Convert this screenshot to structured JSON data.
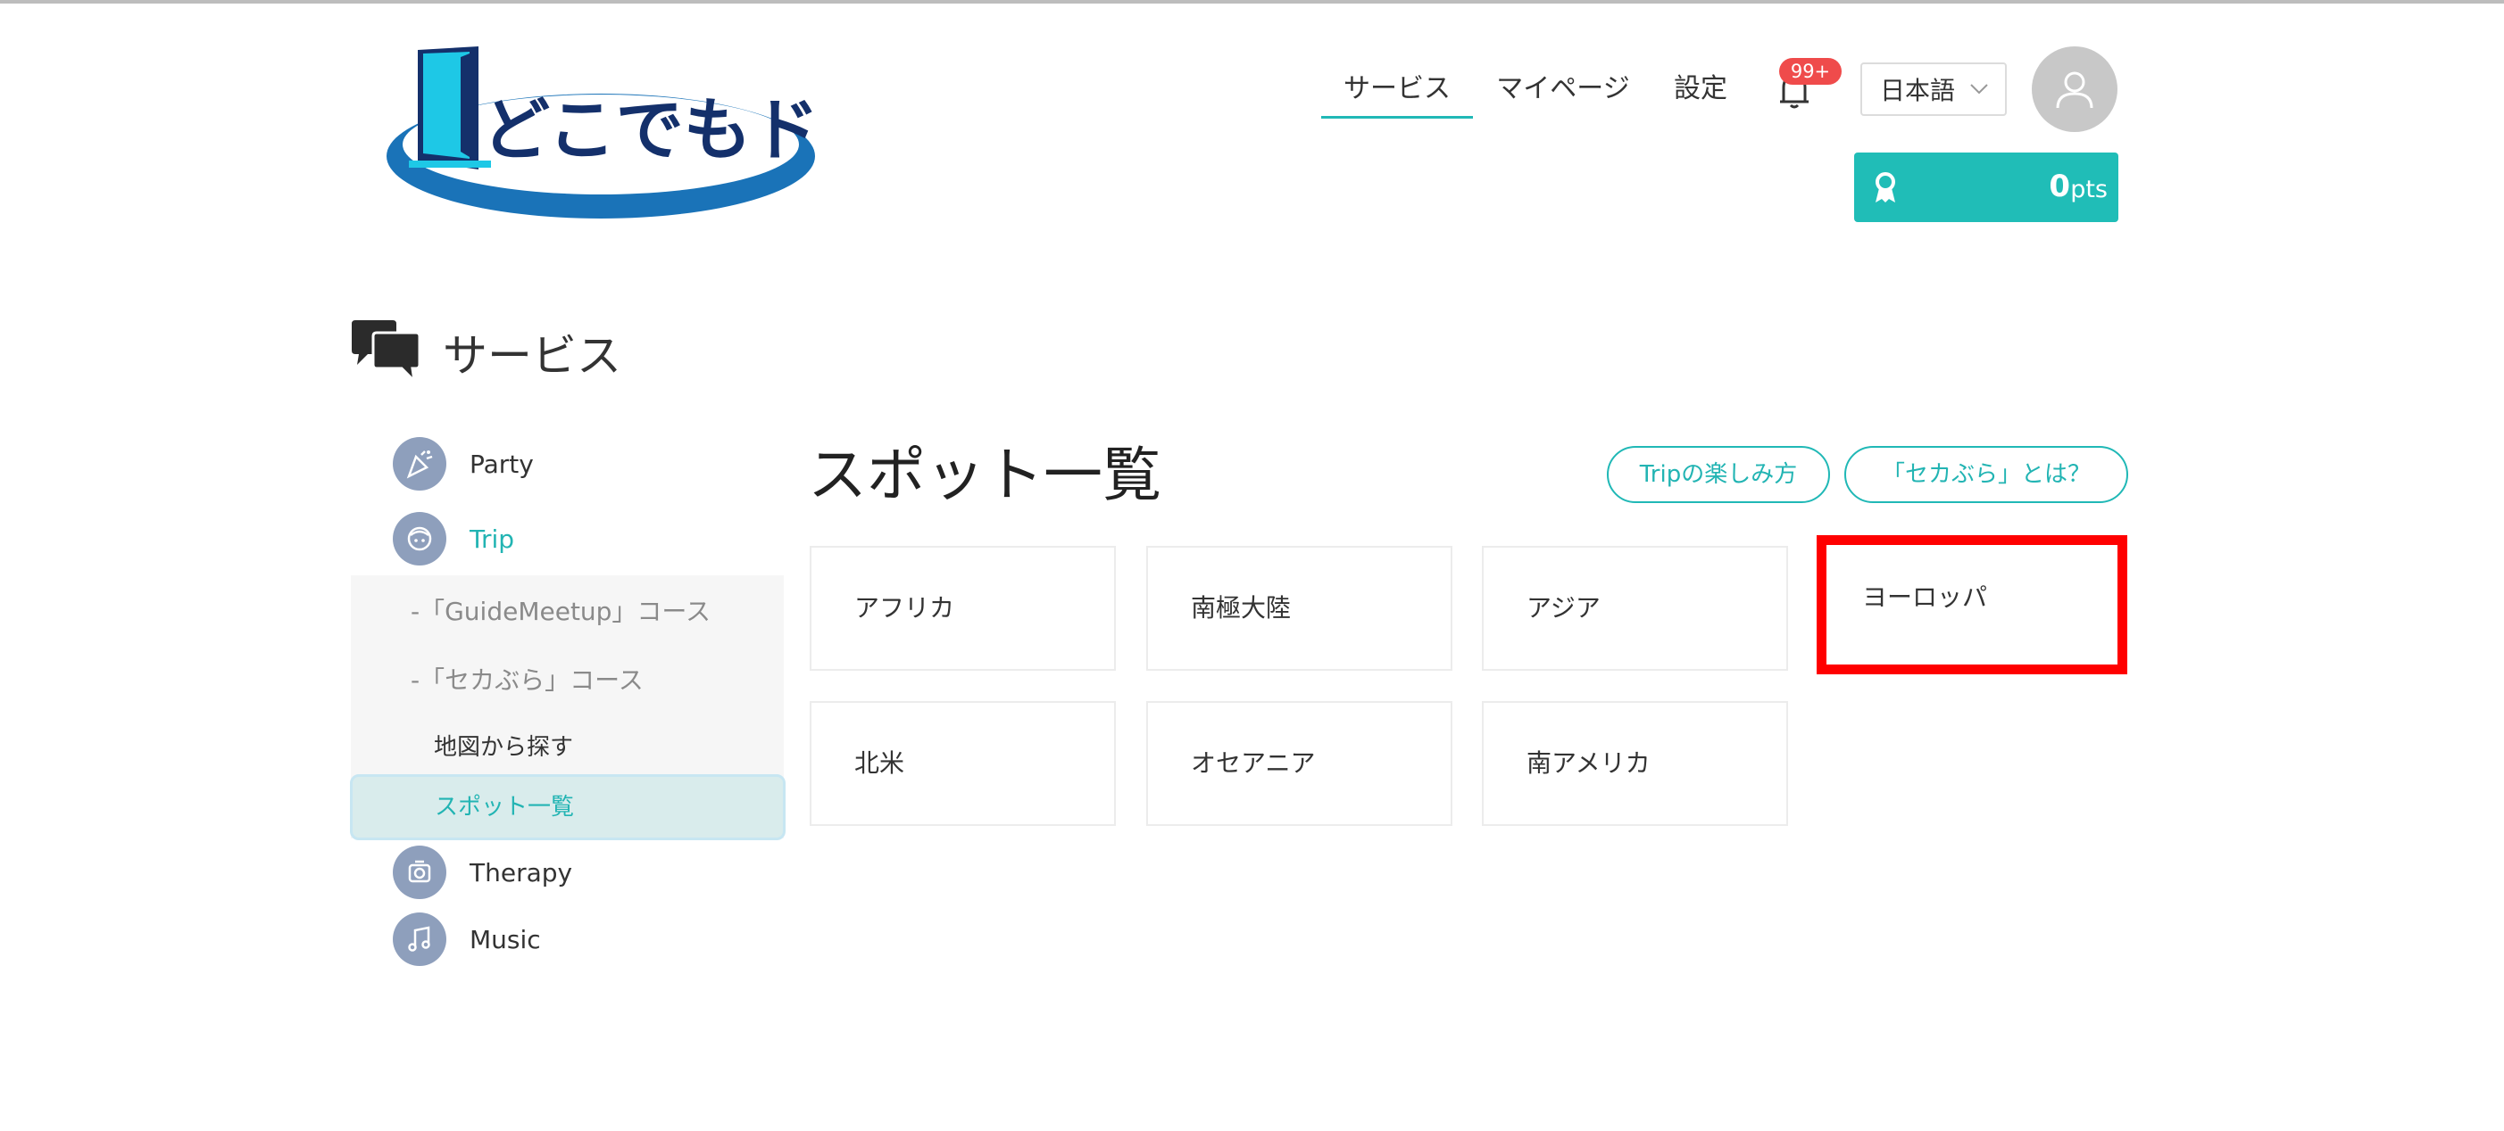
{
  "header": {
    "logo_text": "どこでもドア",
    "nav": {
      "services": "サービス",
      "mypage": "マイページ",
      "settings": "設定"
    },
    "notifications": {
      "badge": "99+",
      "icon": "bell-icon"
    },
    "language": {
      "selected": "日本語",
      "icon": "chevron-down-icon"
    },
    "user": {
      "icon": "user-icon"
    },
    "points": {
      "value": "0",
      "unit": "pts",
      "icon": "ribbon-icon"
    }
  },
  "page": {
    "heading": "サービス",
    "heading_icon": "chat-bubbles-icon"
  },
  "sidebar": {
    "items": [
      {
        "label": "Party",
        "icon": "party-icon"
      },
      {
        "label": "Trip",
        "icon": "trip-icon"
      },
      {
        "label": "Therapy",
        "icon": "therapy-icon"
      },
      {
        "label": "Music",
        "icon": "music-icon"
      }
    ],
    "trip_courses": [
      {
        "label": "-「GuideMeetup」コース"
      },
      {
        "label": "-「セカぶら」コース"
      }
    ],
    "sekabura_links": [
      {
        "label": "地図から探す"
      },
      {
        "label": "スポット一覧"
      }
    ]
  },
  "main": {
    "title": "スポット一覧",
    "buttons": {
      "how_to_enjoy": "Tripの楽しみ方",
      "what_is": "「セカぶら」とは？"
    },
    "regions": [
      {
        "label": "アフリカ"
      },
      {
        "label": "南極大陸"
      },
      {
        "label": "アジア"
      },
      {
        "label": "ヨーロッパ"
      },
      {
        "label": "北米"
      },
      {
        "label": "オセアニア"
      },
      {
        "label": "南アメリカ"
      }
    ]
  },
  "colors": {
    "accent": "#20bdb7",
    "badge": "#ef4b4b",
    "sidebar_icon": "#8e9fbc",
    "highlight": "#ff0000",
    "logo_blue": "#1a73b8",
    "logo_cyan": "#1ec8e6",
    "logo_navy": "#14306b"
  }
}
